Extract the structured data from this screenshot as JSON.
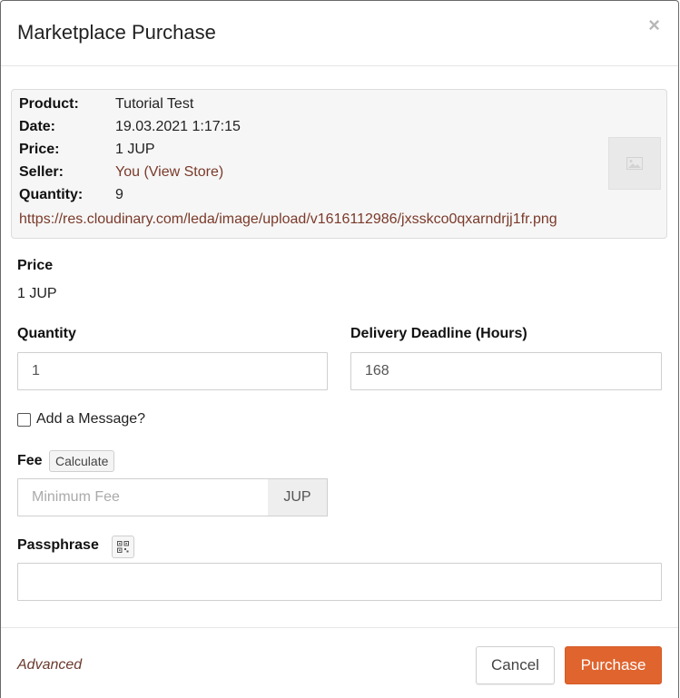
{
  "modal": {
    "title": "Marketplace Purchase",
    "close_symbol": "×"
  },
  "summary": {
    "product_label": "Product:",
    "product_value": "Tutorial Test",
    "date_label": "Date:",
    "date_value": "19.03.2021 1:17:15",
    "price_label": "Price:",
    "price_value": "1 JUP",
    "seller_label": "Seller:",
    "seller_value": "You",
    "seller_open_paren": "(",
    "seller_link": "View Store",
    "seller_close_paren": ")",
    "quantity_label": "Quantity:",
    "quantity_value": "9",
    "image_url": "https://res.cloudinary.com/leda/image/upload/v1616112986/jxsskco0qxarndrjj1fr.png",
    "thumbnail_icon": "image-placeholder-icon"
  },
  "form": {
    "price_label": "Price",
    "price_value": "1 JUP",
    "quantity_label": "Quantity",
    "quantity_value": "1",
    "deadline_label": "Delivery Deadline (Hours)",
    "deadline_value": "168",
    "message_checkbox_label": "Add a Message?",
    "message_checked": false,
    "fee_label": "Fee",
    "calculate_button": "Calculate",
    "fee_placeholder": "Minimum Fee",
    "fee_value": "",
    "fee_unit": "JUP",
    "passphrase_label": "Passphrase",
    "passphrase_icon": "qr-code-icon",
    "passphrase_value": ""
  },
  "footer": {
    "advanced_link": "Advanced",
    "cancel_button": "Cancel",
    "purchase_button": "Purchase"
  },
  "colors": {
    "accent": "#e0642e",
    "link": "#7a3a2a",
    "summary_bg": "#f6f6f6"
  }
}
